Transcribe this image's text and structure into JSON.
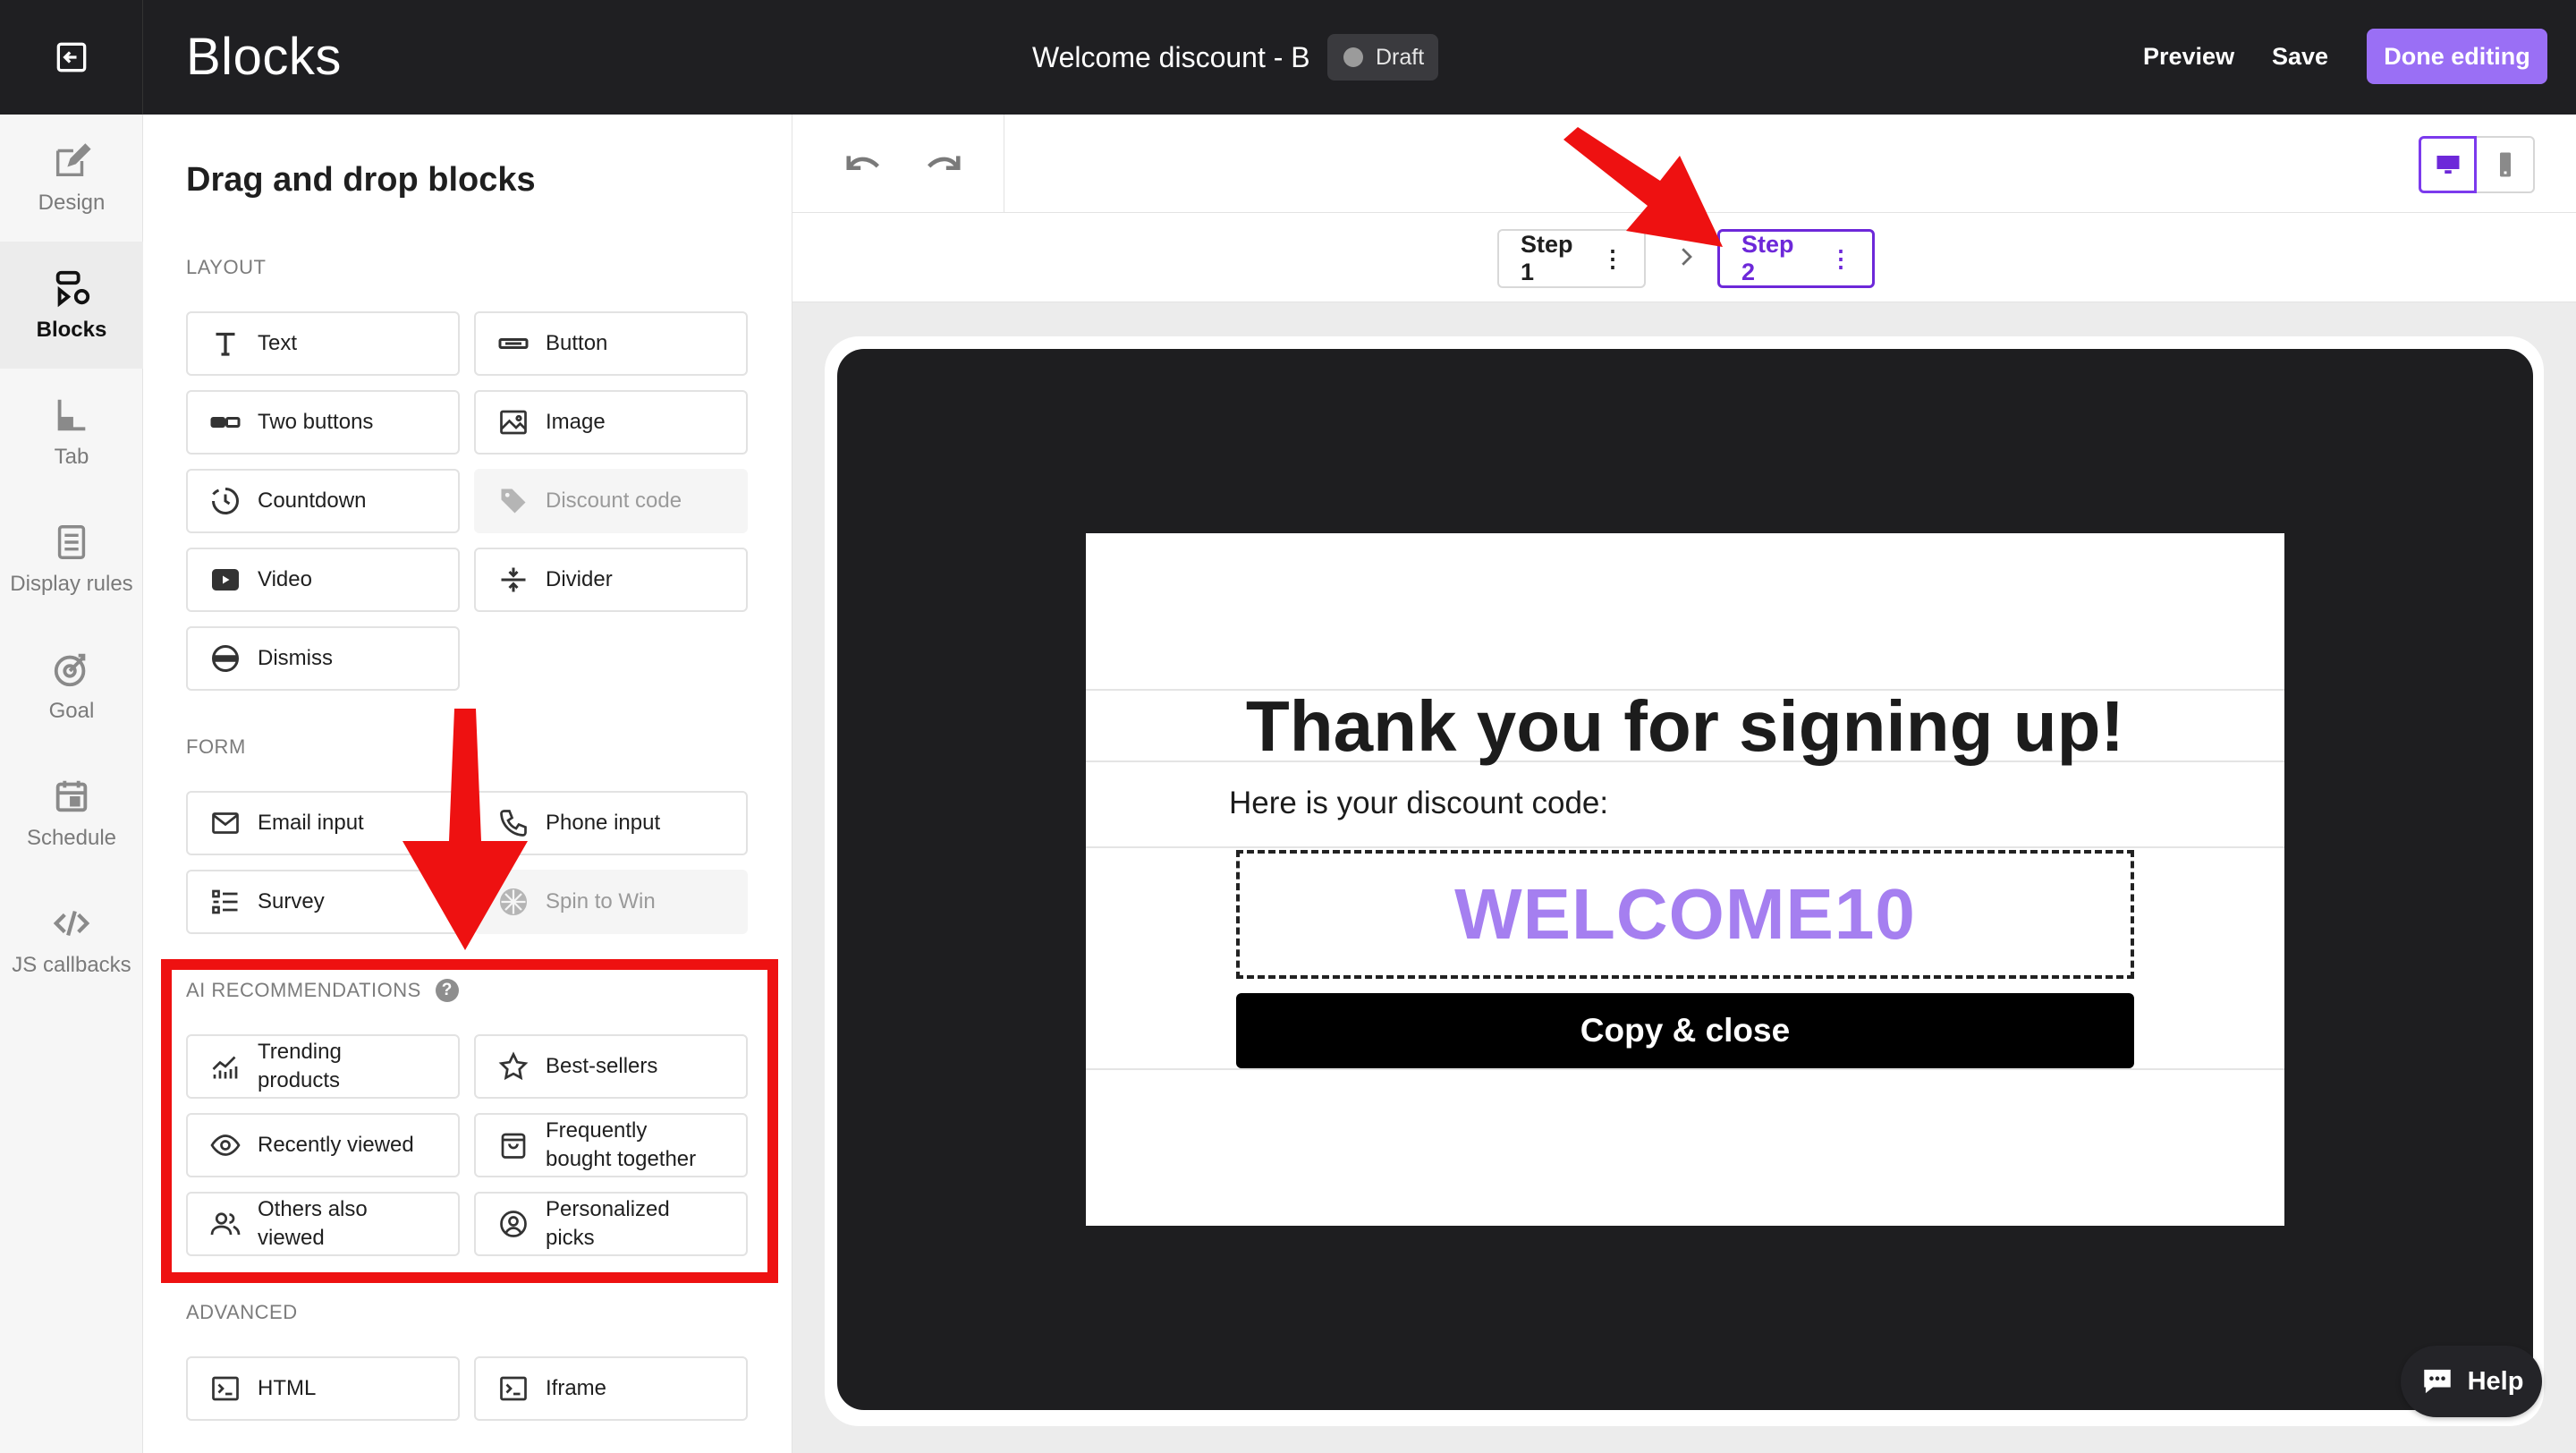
{
  "topbar": {
    "app_title": "Blocks",
    "doc_title": "Welcome discount - B",
    "status": "Draft",
    "preview_label": "Preview",
    "save_label": "Save",
    "done_label": "Done editing"
  },
  "nav": {
    "items": [
      {
        "label": "Design",
        "icon": "brush-icon"
      },
      {
        "label": "Blocks",
        "icon": "blocks-icon"
      },
      {
        "label": "Tab",
        "icon": "tab-icon"
      },
      {
        "label": "Display rules",
        "icon": "document-icon"
      },
      {
        "label": "Goal",
        "icon": "target-icon"
      },
      {
        "label": "Schedule",
        "icon": "calendar-icon"
      },
      {
        "label": "JS callbacks",
        "icon": "code-icon"
      }
    ],
    "active": "Blocks"
  },
  "panel": {
    "title": "Drag and drop blocks",
    "sections": {
      "layout": "LAYOUT",
      "form": "FORM",
      "ai": "AI RECOMMENDATIONS",
      "advanced": "ADVANCED"
    },
    "layout_blocks": {
      "text": "Text",
      "button": "Button",
      "two_buttons": "Two buttons",
      "image": "Image",
      "countdown": "Countdown",
      "discount_code": "Discount code",
      "video": "Video",
      "divider": "Divider",
      "dismiss": "Dismiss"
    },
    "form_blocks": {
      "email_input": "Email input",
      "phone_input": "Phone input",
      "survey": "Survey",
      "spin_to_win": "Spin to Win"
    },
    "ai_blocks": {
      "trending_1": "Trending",
      "trending_2": "products",
      "best_sellers": "Best-sellers",
      "recently_viewed": "Recently viewed",
      "fbt_1": "Frequently",
      "fbt_2": "bought together",
      "others_1": "Others also",
      "others_2": "viewed",
      "personalized_1": "Personalized",
      "personalized_2": "picks"
    },
    "advanced_blocks": {
      "html": "HTML",
      "iframe": "Iframe"
    }
  },
  "steps": {
    "step1": "Step 1",
    "step2": "Step 2",
    "active": "Step 2"
  },
  "popup": {
    "heading": "Thank you for signing up!",
    "subtext": "Here is your discount code:",
    "code": "WELCOME10",
    "button": "Copy & close"
  },
  "help": {
    "label": "Help"
  },
  "colors": {
    "topbar_bg": "#1f1f22",
    "accent_purple": "#9a6ff5",
    "step_active": "#6d28d9",
    "code_color": "#a57ff0",
    "annotation_red": "#ee1111"
  }
}
